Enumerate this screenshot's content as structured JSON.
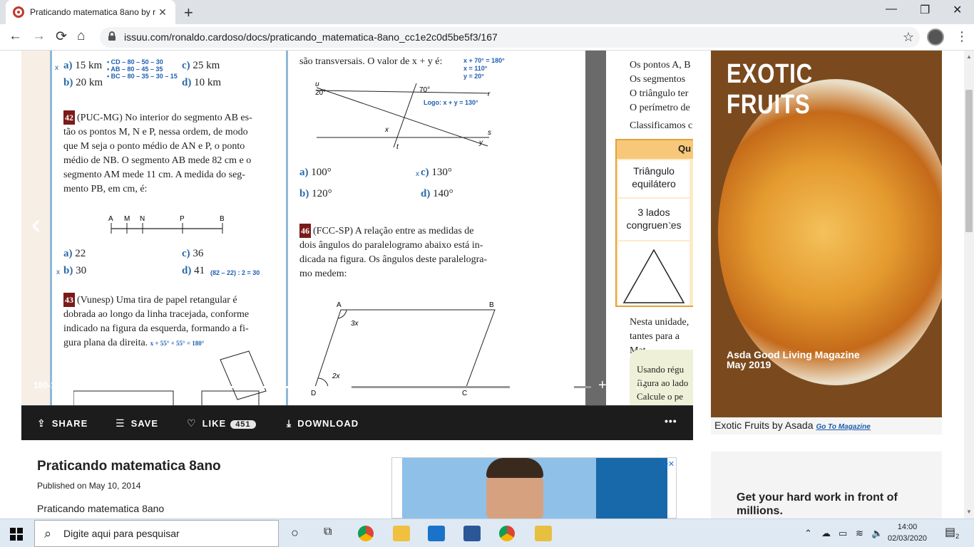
{
  "browser": {
    "tab_title": "Praticando matematica 8ano by r",
    "tab_close": "✕",
    "new_tab": "+",
    "minimize": "—",
    "maximize": "❐",
    "close": "✕",
    "url": "issuu.com/ronaldo.cardoso/docs/praticando_matematica-8ano_cc1e2c0d5be5f3/167",
    "back": "←",
    "forward": "→",
    "reload": "⟳",
    "home": "⌂",
    "star": "☆",
    "menu": "⋮"
  },
  "reader": {
    "page_left": {
      "opt_a": "a)",
      "val_a": "15 km",
      "opt_c": "c)",
      "val_c": "25 km",
      "opt_b": "b)",
      "val_b": "20 km",
      "opt_d": "d)",
      "val_d": "10 km",
      "note_cd": "• CD – 80 – 50 – 30",
      "note_ab": "• AB – 80 – 45 – 35",
      "note_bc": "• BC – 80 – 35 – 30 – 15",
      "q42_num": "42",
      "q42_l1": "(PUC-MG) No interior do segmento AB es-",
      "q42_l2": "tão os pontos M, N e P, nessa ordem, de modo",
      "q42_l3": "que M seja o ponto médio de AN e P, o ponto",
      "q42_l4": "médio de NB. O segmento AB mede 82 cm e o",
      "q42_l5": "segmento AM mede 11 cm. A medida do seg-",
      "q42_l6": "mento PB, em cm, é:",
      "seg_labels": [
        "A",
        "M",
        "N",
        "P",
        "B"
      ],
      "q42_a": "a)",
      "q42_a_val": "22",
      "q42_c": "c)",
      "q42_c_val": "36",
      "q42_b": "b)",
      "q42_b_val": "30",
      "q42_d": "d)",
      "q42_d_val": "41",
      "q42_note": "(82 – 22) : 2 = 30",
      "q43_num": "43",
      "q43_l1": "(Vunesp) Uma tira de papel retangular é",
      "q43_l2": "dobrada ao longo da linha tracejada, conforme",
      "q43_l3": "indicado na figura da esquerda, formando a fi-",
      "q43_l4": "gura plana da direita.",
      "q43_note": "x + 55° + 55° = 180°",
      "mark": "x"
    },
    "page_mid": {
      "q45_tail": "são transversais. O valor de x + y é:",
      "note1": "x + 70° = 180°",
      "note2": "x = 110°",
      "note3": "y = 20°",
      "logo": "Logo: x + y = 130°",
      "fig_u": "u",
      "fig_20": "20°",
      "fig_70": "70°",
      "fig_r": "r",
      "fig_x": "x",
      "fig_t": "t",
      "fig_s": "s",
      "fig_y": "y",
      "a": "a)",
      "a_val": "100°",
      "c": "c)",
      "c_val": "130°",
      "b": "b)",
      "b_val": "120°",
      "d": "d)",
      "d_val": "140°",
      "q46_num": "46",
      "q46_l1": "(FCC-SP) A relação entre as medidas de",
      "q46_l2": "dois ângulos do paralelogramo abaixo está in-",
      "q46_l3": "dicada na figura. Os ângulos deste paralelogra-",
      "q46_l4": "mo medem:",
      "fig_A": "A",
      "fig_B": "B",
      "fig_3x": "3x",
      "fig_2x": "2x",
      "fig_D": "D",
      "fig_C": "C"
    },
    "page_right": {
      "l1": "Os pontos A, B",
      "l2": "Os segmentos",
      "l3": "O triângulo ter",
      "l4": "O perímetro de",
      "l5": "Classificamos c",
      "table_head": "Qu",
      "cell1": "Triângulo equilátero",
      "cell2": "3 lados congruentes",
      "l6": "Nesta unidade,",
      "l7": "tantes para a Mat",
      "l8": "Usando régu",
      "l9": "figura ao lado",
      "l10": "Calcule o pe"
    },
    "page_counter": "180-181 / 304",
    "page_progress": 0.59,
    "zoom_level": 0.6,
    "zoom_out": "—",
    "zoom_in": "+",
    "prev": "‹",
    "next": "›"
  },
  "actions": {
    "share": "SHARE",
    "save": "SAVE",
    "like": "LIKE",
    "like_count": "451",
    "download": "DOWNLOAD",
    "more": "•••"
  },
  "doc": {
    "title": "Praticando matematica 8ano",
    "published": "Published on May 10, 2014",
    "description": "Praticando matematica 8ano"
  },
  "ad": {
    "headline": "EXOTIC FRUITS",
    "sub1": "Asda Good Living Magazine",
    "sub2": "May 2019",
    "caption": "Exotic Fruits by Asada",
    "link": "Go To Magazine",
    "ad_mark": "ⓘ✕",
    "side_text": "Get your hard work in front of millions."
  },
  "taskbar": {
    "search_placeholder": "Digite aqui para pesquisar",
    "time": "14:00",
    "date": "02/03/2020",
    "notif": "2"
  }
}
